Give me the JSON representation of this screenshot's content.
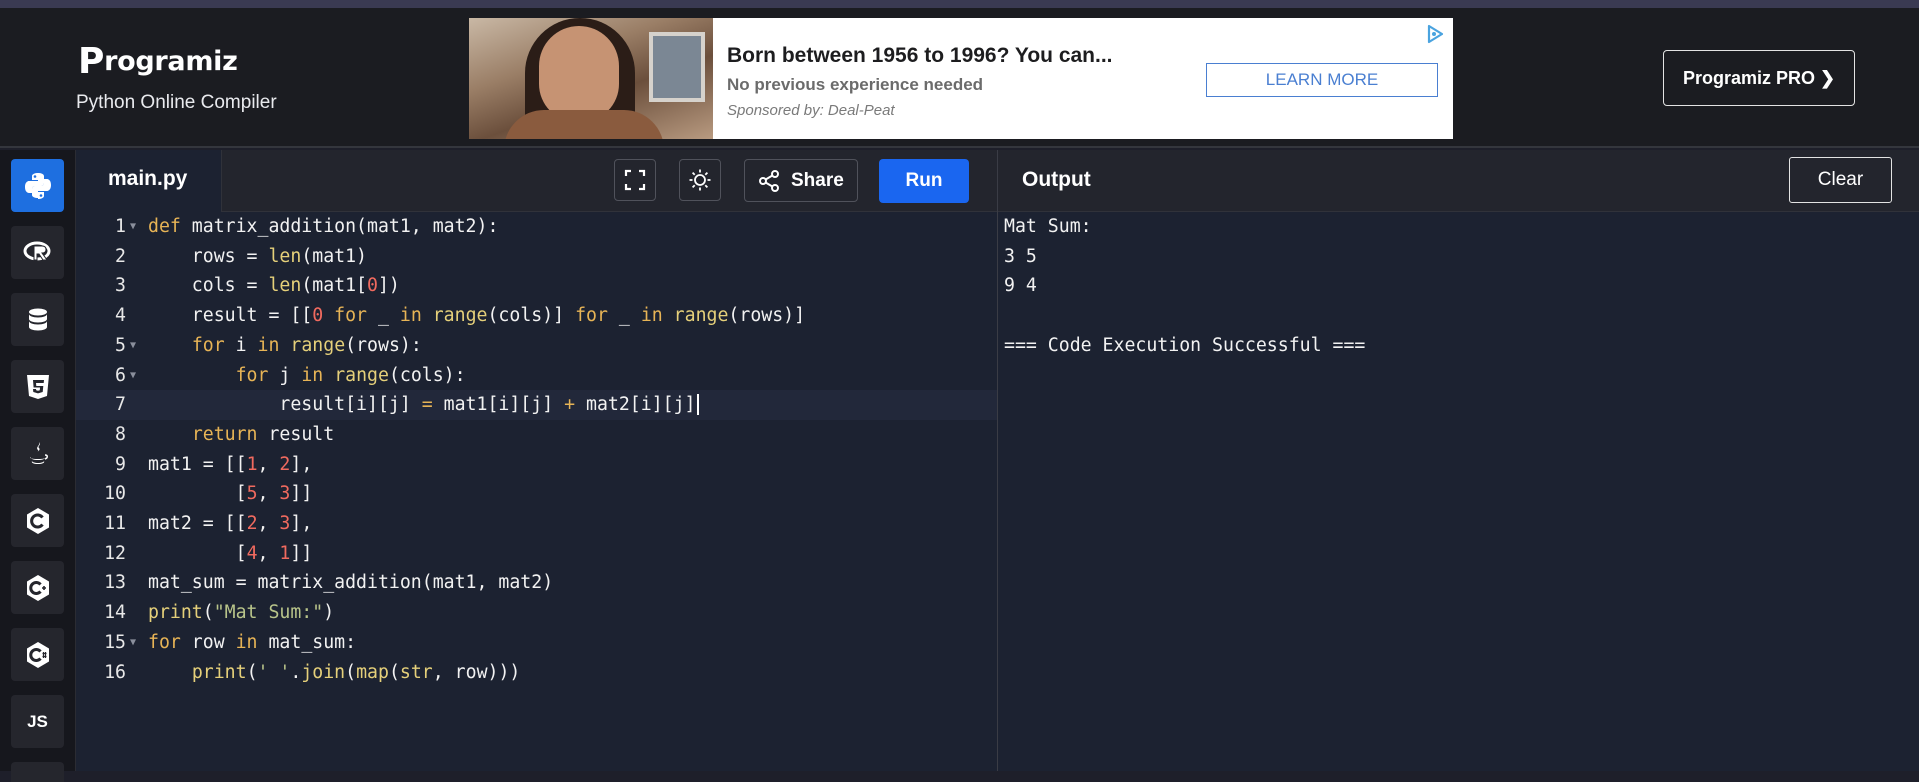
{
  "header": {
    "logo_text": "rogramiz",
    "logo_p": "P",
    "subtitle": "Python Online Compiler",
    "pro_button": "Programiz PRO ❯"
  },
  "ad": {
    "title": "Born between 1956 to 1996? You can...",
    "subtitle": "No previous experience needed",
    "sponsor": "Sponsored by: Deal-Peat",
    "cta": "LEARN MORE"
  },
  "sidebar": {
    "items": [
      {
        "name": "python-icon",
        "label": "Python"
      },
      {
        "name": "r-icon",
        "label": "R"
      },
      {
        "name": "database-icon",
        "label": "SQL"
      },
      {
        "name": "html5-icon",
        "label": "HTML"
      },
      {
        "name": "java-icon",
        "label": "Java"
      },
      {
        "name": "c-icon",
        "label": "C"
      },
      {
        "name": "cplusplus-icon",
        "label": "C++"
      },
      {
        "name": "csharp-icon",
        "label": "C#"
      },
      {
        "name": "js-icon",
        "label": "JS"
      }
    ]
  },
  "editor": {
    "tab": "main.py",
    "share": "Share",
    "run": "Run"
  },
  "output": {
    "title": "Output",
    "clear": "Clear",
    "lines": [
      "Mat Sum:",
      "3 5",
      "9 4",
      "",
      "=== Code Execution Successful ==="
    ]
  },
  "code": {
    "line_numbers": [
      "1",
      "2",
      "3",
      "4",
      "5",
      "6",
      "7",
      "8",
      "9",
      "10",
      "11",
      "12",
      "13",
      "14",
      "15",
      "16"
    ],
    "lines": [
      "def matrix_addition(mat1, mat2):",
      "    rows = len(mat1)",
      "    cols = len(mat1[0])",
      "    result = [[0 for _ in range(cols)] for _ in range(rows)]",
      "    for i in range(rows):",
      "        for j in range(cols):",
      "            result[i][j] = mat1[i][j] + mat2[i][j]",
      "    return result",
      "mat1 = [[1, 2],",
      "        [5, 3]]",
      "mat2 = [[2, 3],",
      "        [4, 1]]",
      "mat_sum = matrix_addition(mat1, mat2)",
      "print(\"Mat Sum:\")",
      "for row in mat_sum:",
      "    print(' '.join(map(str, row)))"
    ],
    "current_line": 7
  },
  "colors": {
    "run_button": "#1a66f0",
    "active_sidebar": "#1e6fe0",
    "keyword": "#e7b456",
    "number": "#f06a5f",
    "string": "#b8c48a"
  }
}
